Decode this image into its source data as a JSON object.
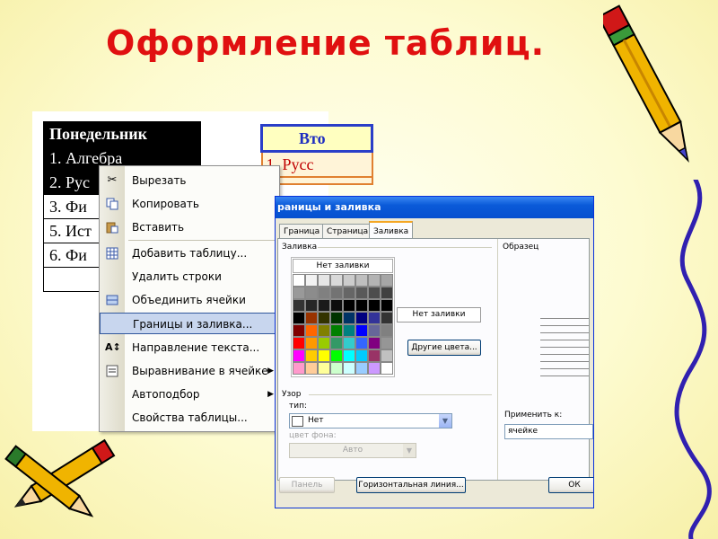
{
  "title": "Оформление таблиц.",
  "table_left": {
    "header": "Понедельник",
    "rows": [
      "1. Алгебра",
      "2. Рус",
      "3. Фи",
      "5. Ист",
      "6. Фи"
    ]
  },
  "table_right": {
    "header": "Вто",
    "row1": "1. Русс"
  },
  "context_menu": {
    "items": [
      {
        "label": "Вырезать",
        "icon": "scissors-icon"
      },
      {
        "label": "Копировать",
        "icon": "copy-icon"
      },
      {
        "label": "Вставить",
        "icon": "paste-icon"
      },
      {
        "label": "Добавить таблицу...",
        "icon": "insert-table-icon"
      },
      {
        "label": "Удалить строки",
        "icon": ""
      },
      {
        "label": "Объединить ячейки",
        "icon": "merge-cells-icon"
      },
      {
        "label": "Границы и заливка...",
        "icon": ""
      },
      {
        "label": "Направление текста...",
        "icon": "text-direction-icon"
      },
      {
        "label": "Выравнивание в ячейке",
        "icon": "cell-align-icon"
      },
      {
        "label": "Автоподбор",
        "icon": ""
      },
      {
        "label": "Свойства таблицы...",
        "icon": ""
      }
    ]
  },
  "dialog": {
    "title": "раницы и заливка",
    "tabs": [
      "Граница",
      "Страница",
      "Заливка"
    ],
    "active_tab": "Заливка",
    "fill_label": "Заливка",
    "no_fill": "Нет заливки",
    "no_fill_box": "Нет заливки",
    "more_colors": "Другие цвета...",
    "preview_label": "Образец",
    "pattern_label": "Узор",
    "type_label": "тип:",
    "type_value": "Нет",
    "bg_color_label": "цвет фона:",
    "bg_color_value": "Авто",
    "apply_to_label": "Применить к:",
    "apply_to_value": "ячейке",
    "panel_button": "Панель",
    "hline_button": "Горизонтальная линия...",
    "ok_button": "ОК",
    "palette_colors": [
      "#ffffff",
      "#f2f2f2",
      "#e6e6e6",
      "#d9d9d9",
      "#cccccc",
      "#bfbfbf",
      "#b3b3b3",
      "#a6a6a6",
      "#999999",
      "#8c8c8c",
      "#808080",
      "#737373",
      "#666666",
      "#595959",
      "#4d4d4d",
      "#404040",
      "#333333",
      "#262626",
      "#1a1a1a",
      "#0d0d0d",
      "#000000",
      "#000000",
      "#000000",
      "#000000",
      "#000000",
      "#993300",
      "#333300",
      "#003300",
      "#003366",
      "#000080",
      "#333399",
      "#333333",
      "#800000",
      "#ff6600",
      "#808000",
      "#008000",
      "#008080",
      "#0000ff",
      "#666699",
      "#808080",
      "#ff0000",
      "#ff9900",
      "#99cc00",
      "#339966",
      "#33cccc",
      "#3366ff",
      "#800080",
      "#969696",
      "#ff00ff",
      "#ffcc00",
      "#ffff00",
      "#00ff00",
      "#00ffff",
      "#00ccff",
      "#993366",
      "#c0c0c0",
      "#ff99cc",
      "#ffcc99",
      "#ffff99",
      "#ccffcc",
      "#ccffff",
      "#99ccff",
      "#cc99ff",
      "#ffffff"
    ]
  }
}
